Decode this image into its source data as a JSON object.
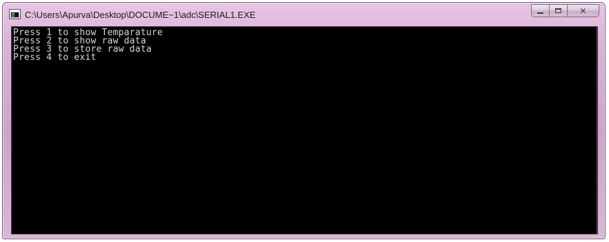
{
  "window": {
    "title": "C:\\Users\\Apurva\\Desktop\\DOCUME~1\\adc\\SERIAL1.EXE",
    "icon": "console-app-icon",
    "controls": {
      "minimize_glyph": "—",
      "maximize_glyph": "□",
      "close_glyph": "✕"
    }
  },
  "console": {
    "background": "#000000",
    "text_color": "#d8d8d8",
    "lines": [
      "Press 1 to show Temparature",
      "Press 2 to show raw data",
      "Press 3 to store raw data",
      "Press 4 to exit"
    ]
  },
  "colors": {
    "titlebar": "#dcb1d8",
    "border": "#6b5a72"
  }
}
